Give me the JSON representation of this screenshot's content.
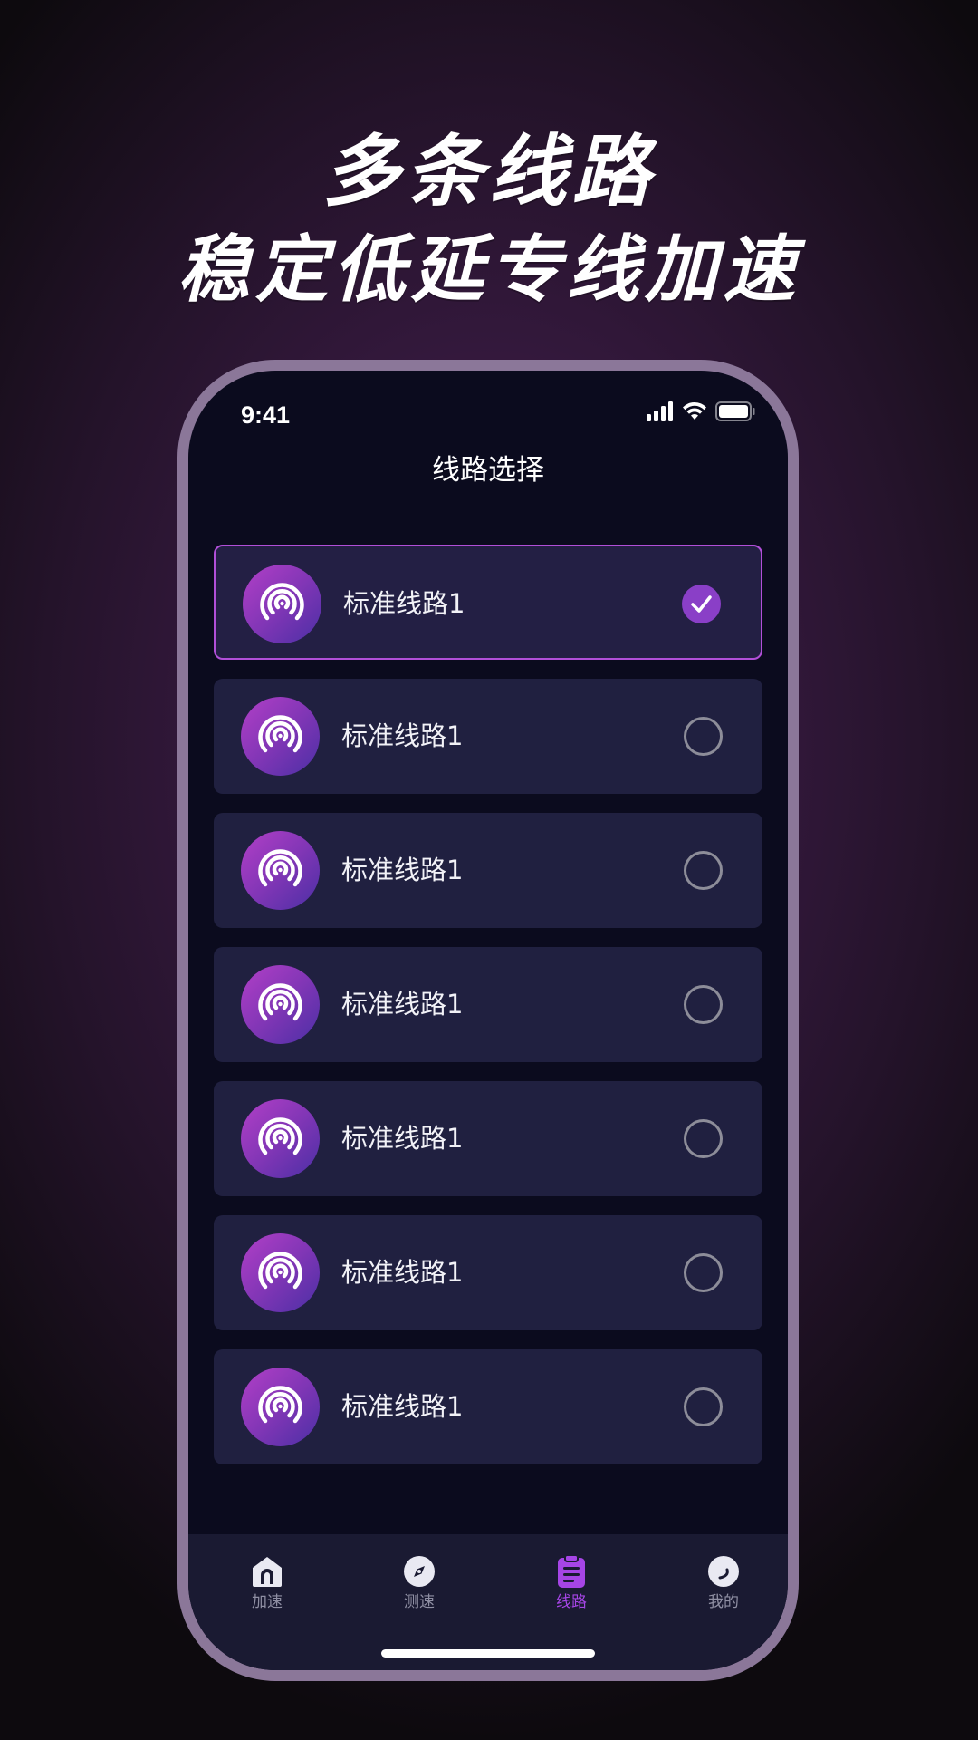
{
  "headline": {
    "line1": "多条线路",
    "line2": "稳定低延专线加速"
  },
  "status_bar": {
    "time": "9:41",
    "icons": [
      "signal-icon",
      "wifi-icon",
      "battery-icon"
    ]
  },
  "page": {
    "title": "线路选择"
  },
  "routes": [
    {
      "label": "标准线路1",
      "selected": true
    },
    {
      "label": "标准线路1",
      "selected": false
    },
    {
      "label": "标准线路1",
      "selected": false
    },
    {
      "label": "标准线路1",
      "selected": false
    },
    {
      "label": "标准线路1",
      "selected": false
    },
    {
      "label": "标准线路1",
      "selected": false
    },
    {
      "label": "标准线路1",
      "selected": false
    }
  ],
  "tabs": [
    {
      "label": "加速",
      "icon": "home-icon",
      "active": false
    },
    {
      "label": "测速",
      "icon": "compass-icon",
      "active": false
    },
    {
      "label": "线路",
      "icon": "clipboard-list-icon",
      "active": true
    },
    {
      "label": "我的",
      "icon": "profile-icon",
      "active": false
    }
  ],
  "colors": {
    "accent": "#a645e6",
    "selected_border": "#b14fd8",
    "card_bg": "#202040",
    "screen_bg": "#0b0b1e",
    "frame": "#8b7799"
  }
}
